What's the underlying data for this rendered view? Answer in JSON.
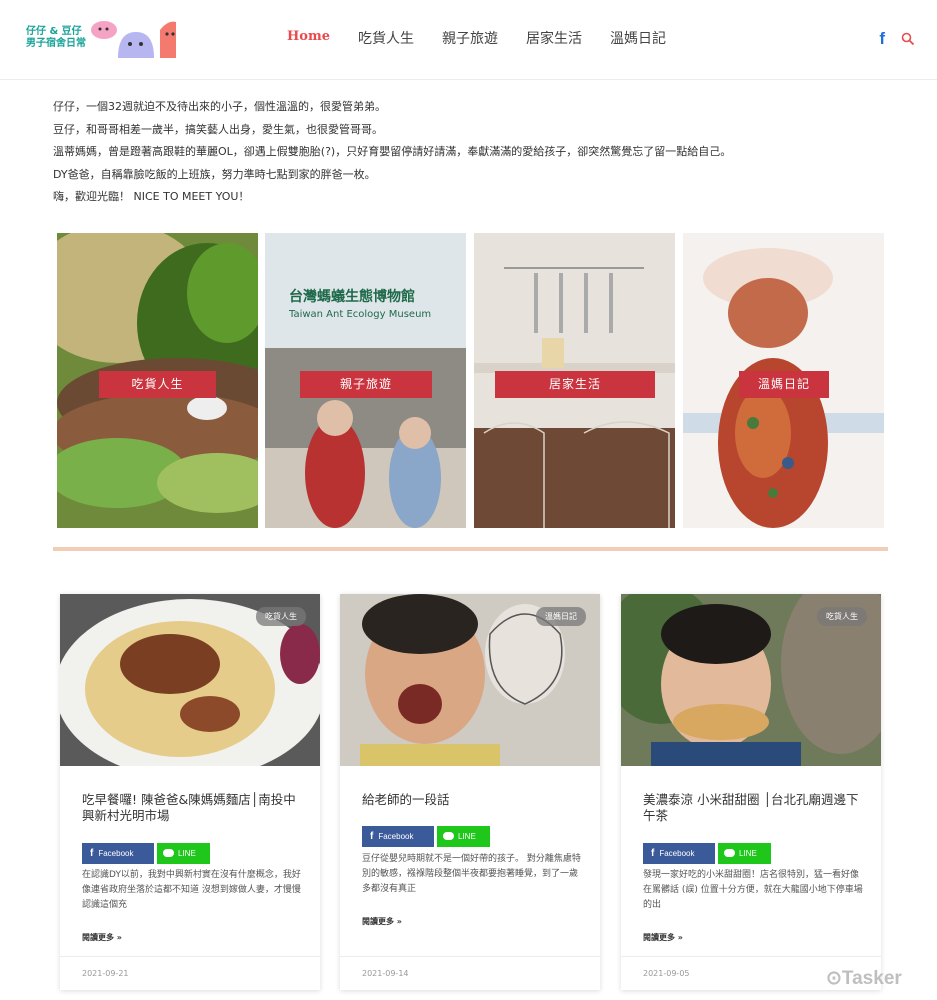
{
  "logo": {
    "line1": "仔仔 & 豆仔",
    "line2": "男子宿舍日常"
  },
  "nav": {
    "items": [
      "Home",
      "吃貨人生",
      "親子旅遊",
      "居家生活",
      "溫媽日記"
    ]
  },
  "intro": {
    "lines": [
      "仔仔，一個32週就迫不及待出來的小子，個性溫溫的，很愛管弟弟。",
      "豆仔，和哥哥相差一歲半，搞笑藝人出身，愛生氣，也很愛管哥哥。",
      "溫蒂媽媽，曾是蹬著高跟鞋的華麗OL，卻遇上假雙胞胎(?)，只好育嬰留停請好請滿，奉獻滿滿的愛給孩子，卻突然驚覺忘了留一點給自己。",
      "DY爸爸，自稱靠臉吃飯的上班族，努力準時七點到家的胖爸一枚。",
      "嗨，歡迎光臨！ NICE TO MEET YOU！"
    ]
  },
  "tiles": [
    {
      "label": "吃貨人生"
    },
    {
      "label": "親子旅遊",
      "sign_line1": "台灣螞蟻生態博物館",
      "sign_line2": "Taiwan Ant Ecology Museum"
    },
    {
      "label": "居家生活"
    },
    {
      "label": "溫媽日記"
    }
  ],
  "cards": [
    {
      "badge": "吃貨人生",
      "title": "吃早餐囉! 陳爸爸&陳媽媽麵店│南投中興新村光明市場",
      "share_fb": "Facebook",
      "share_line": "LINE",
      "excerpt": "在認識DY以前，我對中興新村實在沒有什麼概念，我好像連省政府坐落於這都不知道 沒想到嫁做人妻，才慢慢認識這個充",
      "read_more": "閱讀更多 »",
      "date": "2021-09-21"
    },
    {
      "badge": "溫媽日記",
      "title": "給老師的一段話",
      "share_fb": "Facebook",
      "share_line": "LINE",
      "excerpt": "豆仔從嬰兒時期就不是一個好帶的孩子。 對分離焦慮特別的敏感，襁褓階段整個半夜都要抱著睡覺，到了一歲多都沒有真正",
      "read_more": "閱讀更多 »",
      "date": "2021-09-14"
    },
    {
      "badge": "吃貨人生",
      "title": "美濃泰涼 小米甜甜圈 │台北孔廟週邊下午茶",
      "share_fb": "Facebook",
      "share_line": "LINE",
      "excerpt": "發現一家好吃的小米甜甜圈！店名很特別，猛一看好像在罵髒話 (誤) 位置十分方便，就在大龍國小地下停車場的出",
      "read_more": "閱讀更多 »",
      "date": "2021-09-05"
    }
  ],
  "watermark": "Tasker"
}
